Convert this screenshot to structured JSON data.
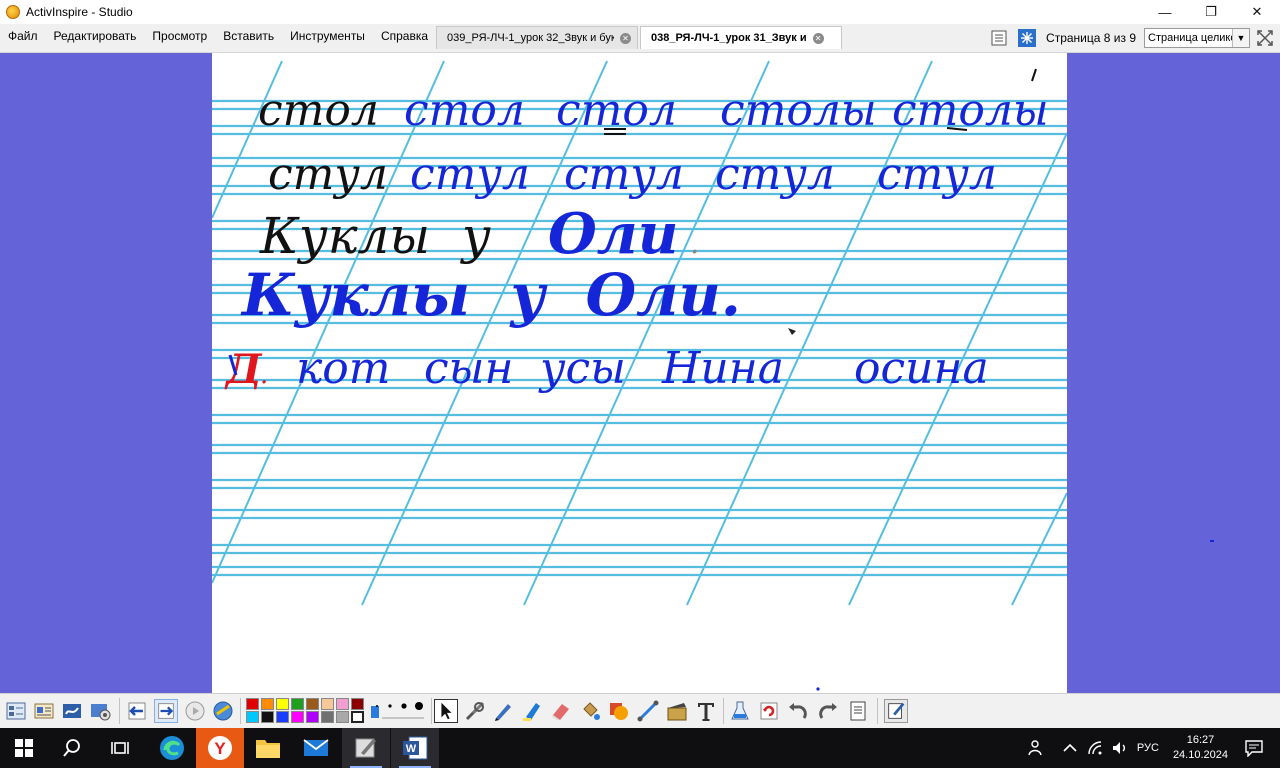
{
  "window": {
    "title": "ActivInspire - Studio",
    "controls": {
      "minimize": "—",
      "maximize": "❐",
      "close": "✕"
    }
  },
  "menu": [
    "Файл",
    "Редактировать",
    "Просмотр",
    "Вставить",
    "Инструменты",
    "Справка"
  ],
  "tabs": [
    {
      "label": "039_РЯ-ЛЧ-1_урок 32_Звук и бук",
      "active": false
    },
    {
      "label": "038_РЯ-ЛЧ-1_урок 31_Звук и",
      "active": true
    }
  ],
  "pagebar": {
    "page_indicator": "Страница 8 из 9",
    "zoom": "Страница целиком"
  },
  "flipchart": {
    "line1": [
      "стол",
      "стол",
      "стол",
      "столы",
      "столы"
    ],
    "line2": [
      "стул",
      "стул",
      "стул",
      "стул",
      "стул"
    ],
    "line3": "Куклы  у",
    "line3_blue": "Оли",
    "line3_dot": ".",
    "line4": "Куклы  у  Оли.",
    "line5_marker": "Д",
    "line5_marker_dot": ".",
    "line5": [
      "кот",
      "сын",
      "усы",
      "Нина",
      "осина"
    ]
  },
  "toolbar": {
    "palette": [
      "#e00000",
      "#ff8c00",
      "#ffff00",
      "#1ea01e",
      "#9a5b1a",
      "#f5c89a",
      "#f0a0d0",
      "#8b0000",
      "#00c8ff",
      "#111111",
      "#1a3cff",
      "#ff00ff",
      "#b000ff",
      "#707070",
      "#a9a9a9",
      "#ffffff"
    ],
    "icons": [
      "flipchart-browser-icon",
      "main-menu-icon",
      "pen-options-icon",
      "tool-settings-icon",
      "previous-page-icon",
      "next-page-icon",
      "play-icon",
      "desktop-annotate-icon",
      "select-icon",
      "resources-icon",
      "pen-icon",
      "highlighter-icon",
      "eraser-icon",
      "fill-icon",
      "shape-icon",
      "connector-icon",
      "clip-icon",
      "text-icon",
      "clear-icon",
      "reset-icon",
      "undo-icon",
      "redo-icon",
      "page-icon",
      "extra-icon"
    ]
  },
  "taskbar": {
    "language": "РУС",
    "time": "16:27",
    "date": "24.10.2024"
  },
  "colors": {
    "workspace": "#6464d8",
    "ink_blue": "#1426d8",
    "ink_black": "#111111",
    "ink_red": "#e0161e",
    "ruling": "#55bde0"
  }
}
